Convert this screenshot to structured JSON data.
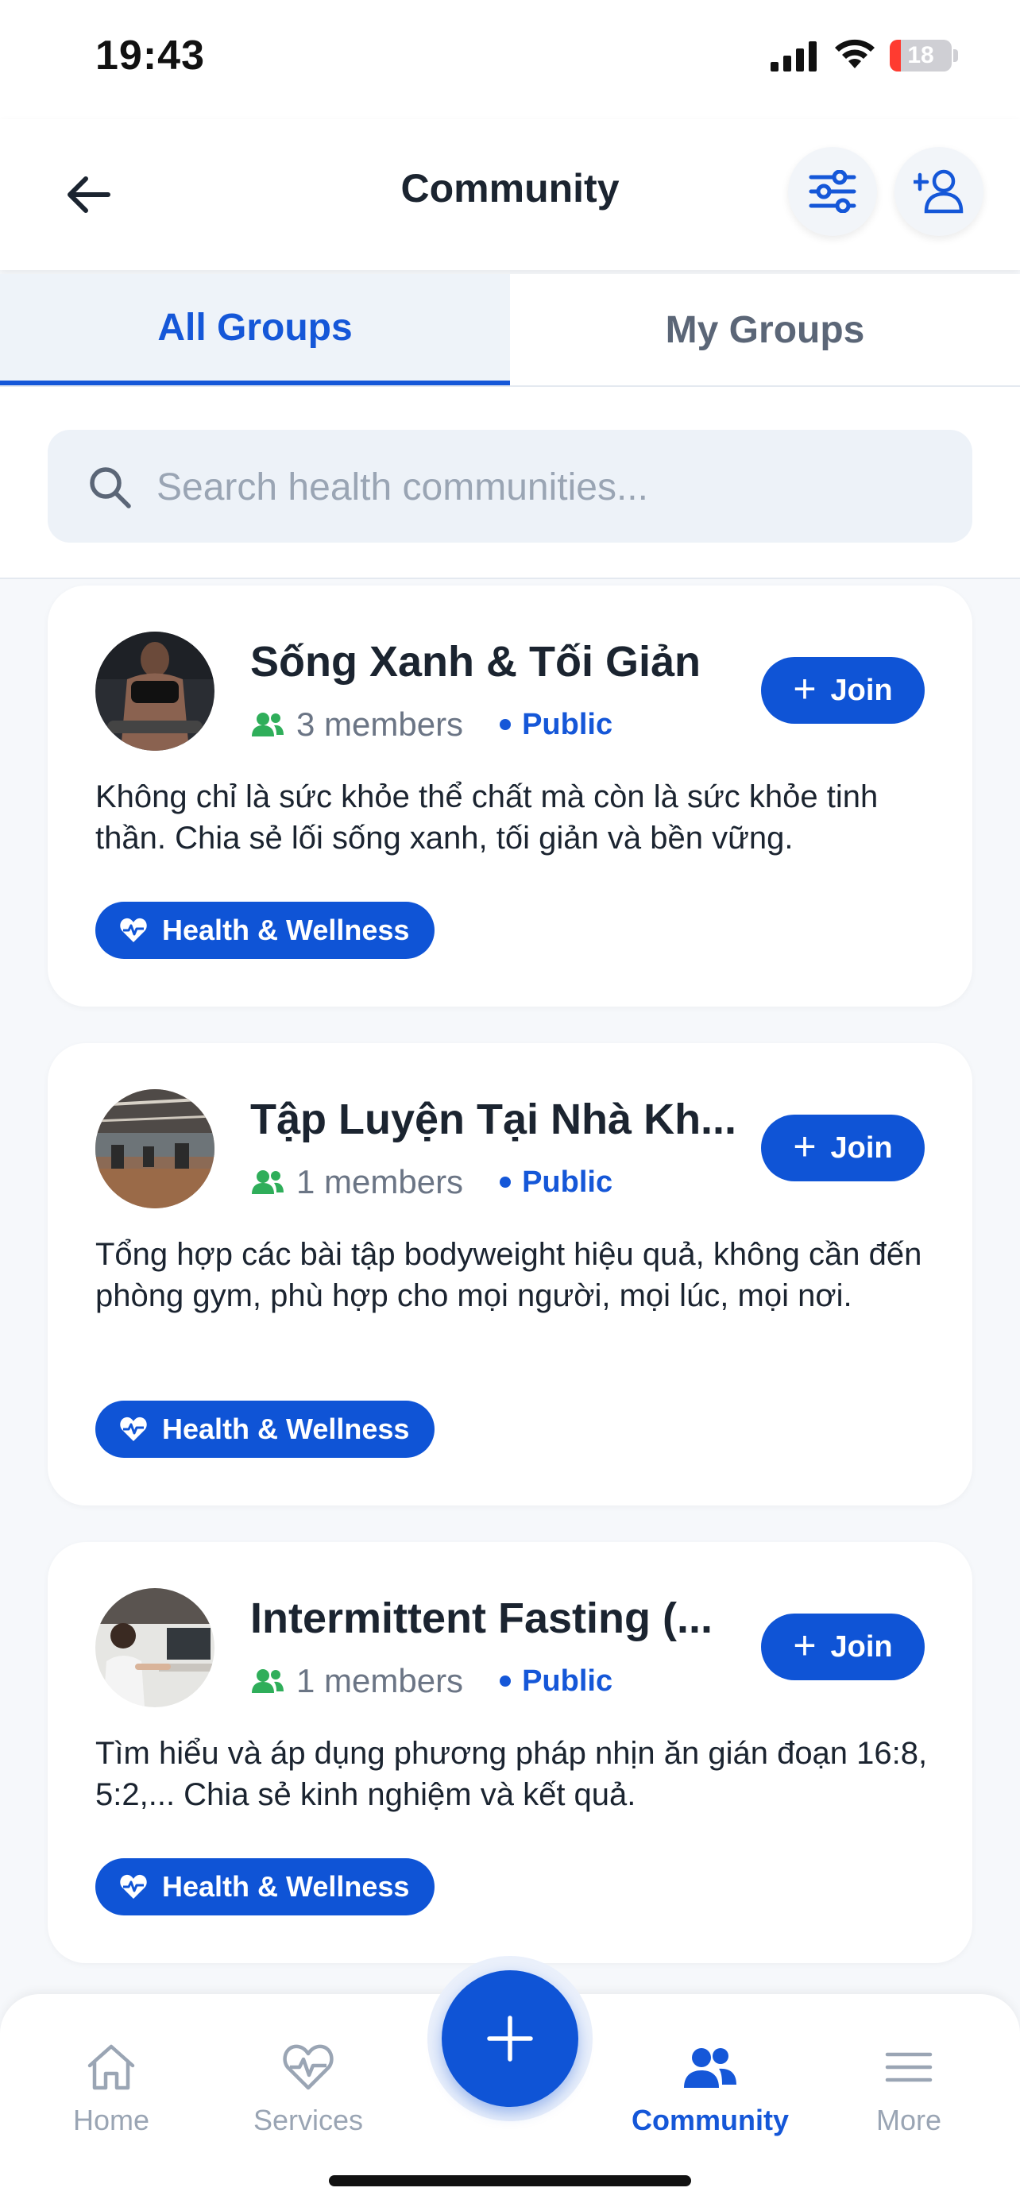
{
  "status_bar": {
    "time": "19:43",
    "battery": "18",
    "battery_level": 0.18
  },
  "header": {
    "title": "Community"
  },
  "tabs": [
    {
      "label": "All Groups",
      "active": true
    },
    {
      "label": "My Groups",
      "active": false
    }
  ],
  "search": {
    "placeholder": "Search health communities..."
  },
  "groups": [
    {
      "name": "Sống Xanh & Tối Giản",
      "members": "3 members",
      "visibility": "Public",
      "join_label": "Join",
      "description": "Không chỉ là sức khỏe thể chất mà còn là sức khỏe tinh thần. Chia sẻ lối sống xanh, tối giản và bền vững.",
      "tag": "Health & Wellness"
    },
    {
      "name": "Tập Luyện Tại Nhà Kh...",
      "members": "1 members",
      "visibility": "Public",
      "join_label": "Join",
      "description": "Tổng hợp các bài tập bodyweight hiệu quả, không cần đến phòng gym, phù hợp cho mọi người, mọi lúc, mọi nơi.",
      "tag": "Health & Wellness"
    },
    {
      "name": "Intermittent Fasting (...",
      "members": "1 members",
      "visibility": "Public",
      "join_label": "Join",
      "description": "Tìm hiểu và áp dụng phương pháp nhịn ăn gián đoạn 16:8, 5:2,... Chia sẻ kinh nghiệm và kết quả.",
      "tag": "Health & Wellness"
    }
  ],
  "bottom_nav": {
    "items": [
      {
        "label": "Home",
        "icon": "home-icon",
        "active": false
      },
      {
        "label": "Services",
        "icon": "heart-pulse-icon",
        "active": false
      },
      {
        "label": "Community",
        "icon": "people-icon",
        "active": true
      },
      {
        "label": "More",
        "icon": "menu-icon",
        "active": false
      }
    ]
  },
  "colors": {
    "accent": "#0f54d6",
    "text": "#1b2430",
    "muted": "#9aa5b4",
    "members_icon": "#2fae5a"
  }
}
